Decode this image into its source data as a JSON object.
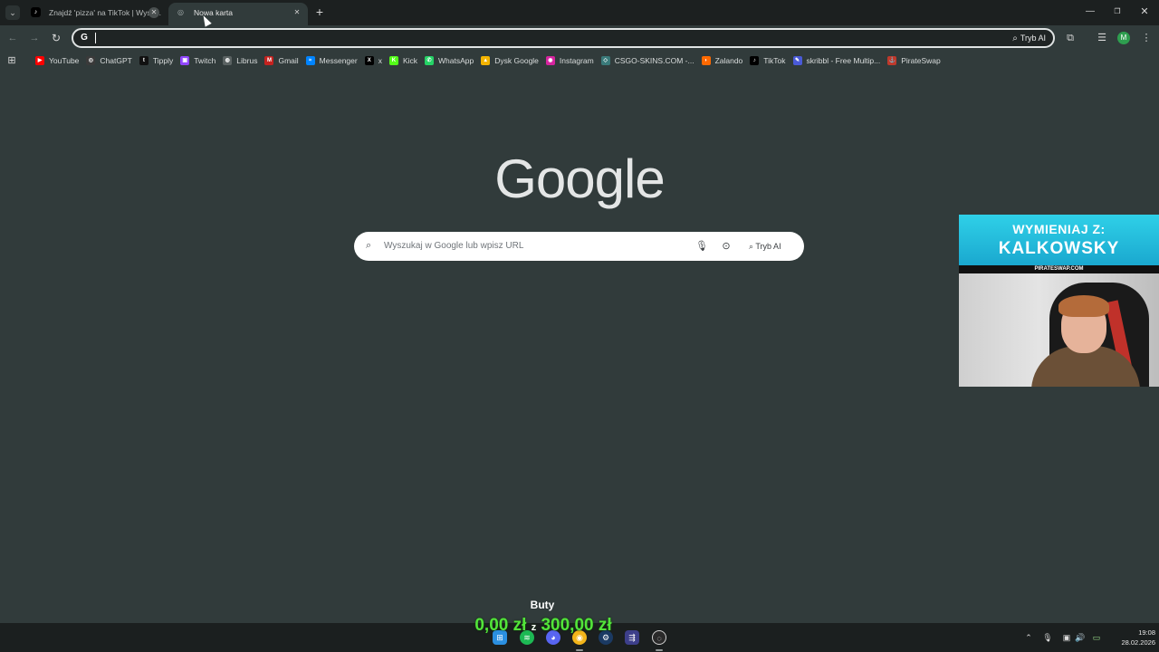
{
  "browser": {
    "tabs": [
      {
        "title": "Znajdź 'pizza' na TikTok | Wysz...",
        "favicon": "tiktok-icon",
        "active": false
      },
      {
        "title": "Nowa karta",
        "favicon": "chrome-newtab-icon",
        "active": true
      }
    ],
    "omnibox": {
      "value": "",
      "ai_mode_label": "Tryb AI"
    },
    "profile_initial": "M"
  },
  "bookmarks": [
    {
      "label": "YouTube",
      "icon": "youtube-icon",
      "color": "#ff0000",
      "glyph": "▶"
    },
    {
      "label": "ChatGPT",
      "icon": "chatgpt-icon",
      "color": "#3a3a3a",
      "glyph": "◎"
    },
    {
      "label": "Tipply",
      "icon": "tipply-icon",
      "color": "#111111",
      "glyph": "t"
    },
    {
      "label": "Twitch",
      "icon": "twitch-icon",
      "color": "#9146ff",
      "glyph": "▣"
    },
    {
      "label": "Librus",
      "icon": "librus-icon",
      "color": "#5a6262",
      "glyph": "◍"
    },
    {
      "label": "Gmail",
      "icon": "gmail-icon",
      "color": "#c5221f",
      "glyph": "M"
    },
    {
      "label": "Messenger",
      "icon": "messenger-icon",
      "color": "#0084ff",
      "glyph": "≈"
    },
    {
      "label": "x",
      "icon": "x-icon",
      "color": "#000000",
      "glyph": "X"
    },
    {
      "label": "Kick",
      "icon": "kick-icon",
      "color": "#53fc18",
      "glyph": "K"
    },
    {
      "label": "WhatsApp",
      "icon": "whatsapp-icon",
      "color": "#25d366",
      "glyph": "✆"
    },
    {
      "label": "Dysk Google",
      "icon": "google-drive-icon",
      "color": "#f4b400",
      "glyph": "▲"
    },
    {
      "label": "Instagram",
      "icon": "instagram-icon",
      "color": "#d6249f",
      "glyph": "◉"
    },
    {
      "label": "CSGO-SKINS.COM -...",
      "icon": "csgo-skins-icon",
      "color": "#3a7a7a",
      "glyph": "◇"
    },
    {
      "label": "Zalando",
      "icon": "zalando-icon",
      "color": "#ff6900",
      "glyph": "◗"
    },
    {
      "label": "TikTok",
      "icon": "tiktok-icon",
      "color": "#000000",
      "glyph": "♪"
    },
    {
      "label": "skribbl - Free Multip...",
      "icon": "skribbl-icon",
      "color": "#4a5ad8",
      "glyph": "✎"
    },
    {
      "label": "PirateSwap",
      "icon": "pirateswap-icon",
      "color": "#c0392b",
      "glyph": "⚓"
    }
  ],
  "newtab": {
    "logo_text": "Google",
    "search": {
      "placeholder": "Wyszukaj w Google lub wpisz URL",
      "ai_mode_label": "Tryb AI"
    }
  },
  "stream_overlay": {
    "banner_line1": "WYMIENIAJ Z:",
    "banner_line2": "KALKOWSKY",
    "site": "PIRATESWAP.COM"
  },
  "goal": {
    "title": "Buty",
    "current": "0,00 zł",
    "separator": "z",
    "target": "300,00 zł"
  },
  "taskbar": {
    "time": "19:08",
    "date": "28.02.2026"
  },
  "colors": {
    "page_bg": "#313b3b",
    "tabstrip_bg": "#1c2020",
    "goal_green": "#53e43a",
    "overlay_cyan": "#2fd0e8"
  }
}
